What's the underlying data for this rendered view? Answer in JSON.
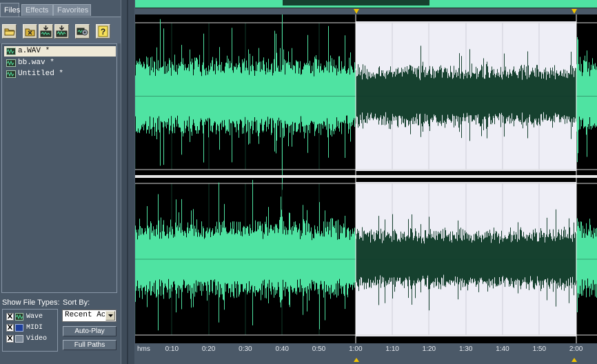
{
  "left_panel": {
    "tabs": [
      {
        "label": "Files",
        "active": true
      },
      {
        "label": "Effects",
        "active": false
      },
      {
        "label": "Favorites",
        "active": false
      }
    ],
    "toolbar_icons": [
      "open-folder-icon",
      "close-file-icon",
      "insert-into-multitrack-icon",
      "insert-into-cd-icon",
      "settings-icon",
      "help-icon"
    ],
    "help_glyph": "?",
    "files": [
      {
        "name": "a.WAV *",
        "selected": true
      },
      {
        "name": "bb.wav *",
        "selected": false
      },
      {
        "name": "Untitled *",
        "selected": false
      }
    ],
    "show_file_types_label": "Show File Types:",
    "file_types": [
      {
        "label": "Wave",
        "checked": true
      },
      {
        "label": "MIDI",
        "checked": true
      },
      {
        "label": "Video",
        "checked": true
      }
    ],
    "check_mark": "X",
    "sort_by_label": "Sort By:",
    "sort_value": "Recent Ac",
    "auto_play_label": "Auto-Play",
    "full_paths_label": "Full Paths"
  },
  "timeline": {
    "unit_label": "hms",
    "ticks": [
      "0:10",
      "0:20",
      "0:30",
      "0:40",
      "0:50",
      "1:00",
      "1:10",
      "1:20",
      "1:30",
      "1:40",
      "1:50",
      "2:00"
    ],
    "selection_start": "1:00",
    "selection_end": "2:00"
  },
  "colors": {
    "waveform": "#4fe3a2",
    "selection_background": "#eeeef6",
    "selected_waveform": "#16412f",
    "panel_background": "#4b5968"
  }
}
